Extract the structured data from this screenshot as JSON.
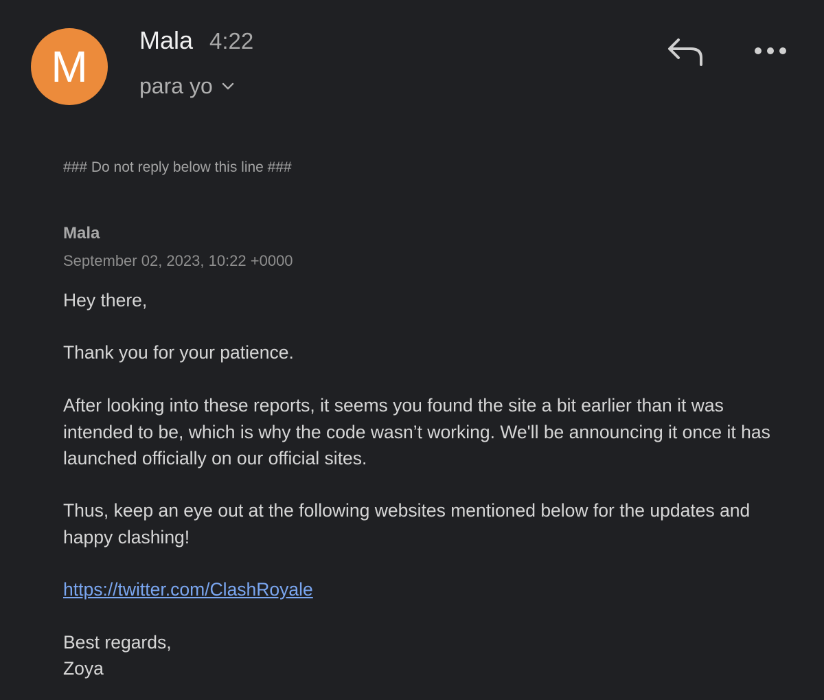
{
  "header": {
    "avatar_letter": "M",
    "avatar_color": "#ec8b3b",
    "sender_name": "Mala",
    "time": "4:22",
    "recipient": "para yo",
    "recipient_icon": "chevron-down-icon",
    "reply_icon": "reply-icon",
    "more_icon": "more-options-icon"
  },
  "message": {
    "separator": "### Do not reply below this line ###",
    "author": "Mala",
    "date": "September 02, 2023, 10:22 +0000",
    "greeting": "Hey there,",
    "paragraph_1": "Thank you for your patience.",
    "paragraph_2": "After looking into these reports, it seems you found the site a bit earlier than it was intended to be, which is why the code wasn’t working. We'll be announcing it once it has launched officially on our official sites.",
    "paragraph_3": "Thus, keep an eye out at the following websites mentioned below for the updates and happy clashing!",
    "link": "https://twitter.com/ClashRoyale",
    "closing": "Best regards,",
    "signature": "Zoya",
    "link_color": "#7aa6f0"
  }
}
